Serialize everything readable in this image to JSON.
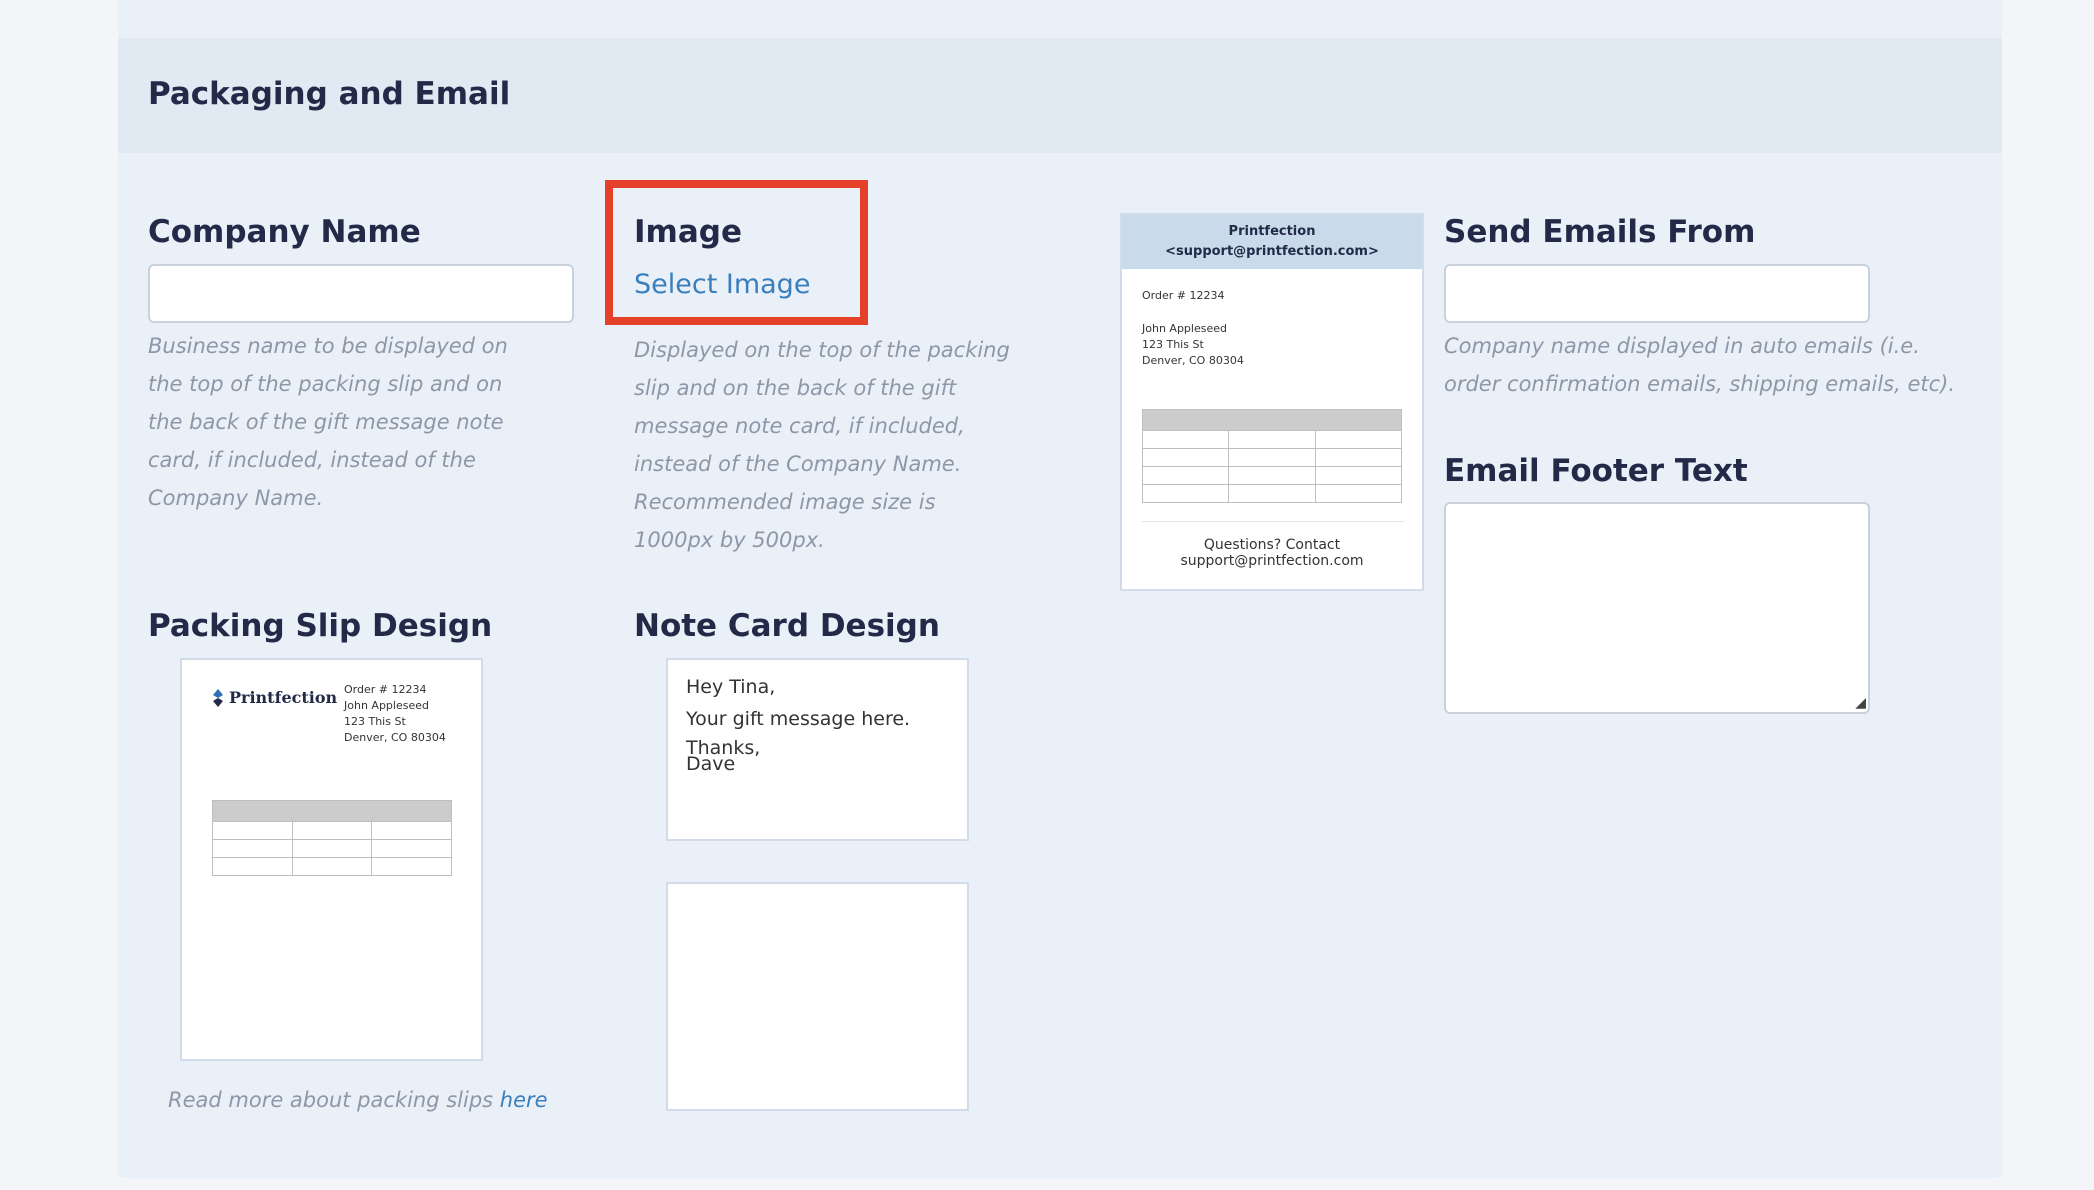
{
  "section": {
    "title": "Packaging and Email"
  },
  "company_name": {
    "label": "Company Name",
    "value": "",
    "help": "Business name to be displayed on the top of the packing slip and on the back of the gift message note card, if included, instead of the Company Name."
  },
  "image": {
    "label": "Image",
    "select_label": "Select Image",
    "help": "Displayed on the top of the packing slip and on the back of the gift message note card, if included, instead of the Company Name. Recommended image size is 1000px by 500px."
  },
  "email_preview": {
    "from_name": "Printfection",
    "from_email": "<support@printfection.com>",
    "order": "Order # 12234",
    "address": [
      "John Appleseed",
      "123 This St",
      "Denver, CO 80304"
    ],
    "footer_line1": "Questions? Contact",
    "footer_line2": "support@printfection.com"
  },
  "send_emails_from": {
    "label": "Send Emails From",
    "value": "",
    "help": "Company name displayed in auto emails (i.e. order confirmation emails, shipping emails, etc)."
  },
  "email_footer": {
    "label": "Email Footer Text",
    "value": ""
  },
  "packing_slip": {
    "label": "Packing Slip Design",
    "logo_text": "Printfection",
    "order": "Order # 12234",
    "address": [
      "John Appleseed",
      "123 This St",
      "Denver, CO 80304"
    ],
    "read_more_prefix": "Read more about packing slips ",
    "read_more_link": "here"
  },
  "note_card": {
    "label": "Note Card Design",
    "greeting": "Hey Tina,",
    "message": "Your gift message here.",
    "signoff": "Thanks,",
    "signature": "Dave"
  },
  "colors": {
    "accent_link": "#3a7fbd",
    "highlight": "#e5402a",
    "heading": "#222a48",
    "help_text": "#8e97a8"
  }
}
